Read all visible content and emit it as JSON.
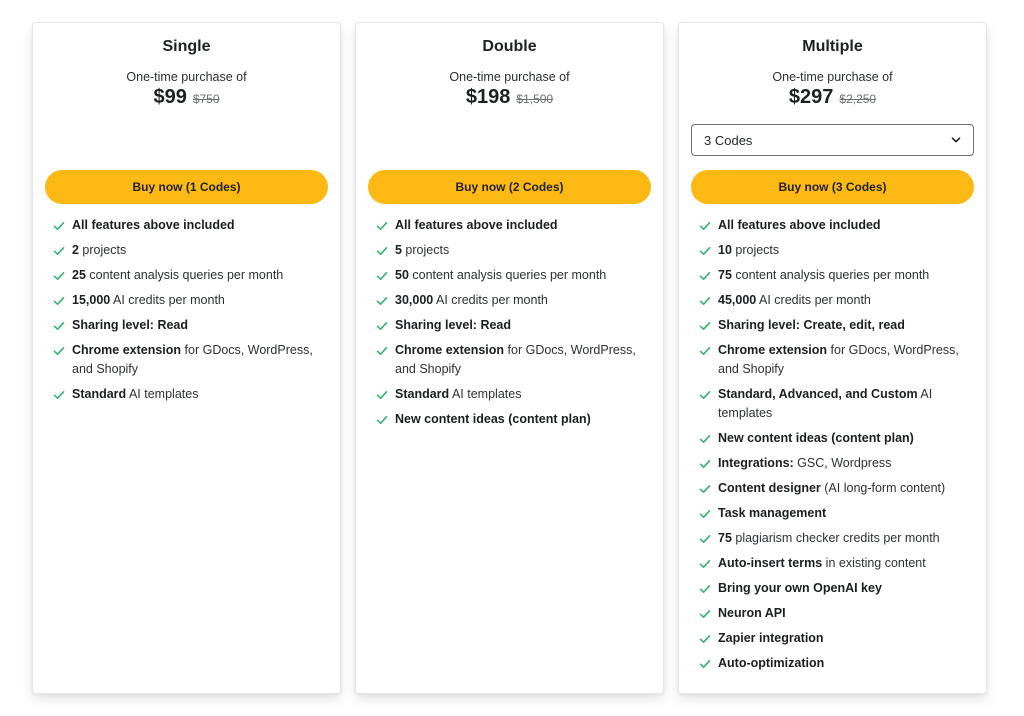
{
  "colors": {
    "accent": "#fdb913",
    "check": "#34b36b"
  },
  "plans": [
    {
      "name": "Single",
      "subtitle": "One-time purchase of",
      "price": "$99",
      "old_price": "$750",
      "button_label": "Buy now (1 Codes)",
      "features": [
        {
          "bold": "All features above included",
          "rest": ""
        },
        {
          "bold": "2",
          "rest": " projects"
        },
        {
          "bold": "25",
          "rest": " content analysis queries per month"
        },
        {
          "bold": "15,000",
          "rest": " AI credits per month"
        },
        {
          "bold": "Sharing level: Read",
          "rest": ""
        },
        {
          "bold": "Chrome extension",
          "rest": " for GDocs, WordPress, and Shopify"
        },
        {
          "bold": "Standard",
          "rest": " AI templates"
        }
      ]
    },
    {
      "name": "Double",
      "subtitle": "One-time purchase of",
      "price": "$198",
      "old_price": "$1,500",
      "button_label": "Buy now (2 Codes)",
      "features": [
        {
          "bold": "All features above included",
          "rest": ""
        },
        {
          "bold": "5",
          "rest": " projects"
        },
        {
          "bold": "50",
          "rest": " content analysis queries per month"
        },
        {
          "bold": "30,000",
          "rest": " AI credits per month"
        },
        {
          "bold": "Sharing level: Read",
          "rest": ""
        },
        {
          "bold": "Chrome extension",
          "rest": " for GDocs, WordPress, and Shopify"
        },
        {
          "bold": "Standard",
          "rest": " AI templates"
        },
        {
          "bold": "New content ideas (content plan)",
          "rest": ""
        }
      ]
    },
    {
      "name": "Multiple",
      "subtitle": "One-time purchase of",
      "price": "$297",
      "old_price": "$2,250",
      "select_value": "3 Codes",
      "button_label": "Buy now (3 Codes)",
      "features": [
        {
          "bold": "All features above included",
          "rest": ""
        },
        {
          "bold": "10",
          "rest": " projects"
        },
        {
          "bold": "75",
          "rest": " content analysis queries per month"
        },
        {
          "bold": "45,000",
          "rest": " AI credits per month"
        },
        {
          "bold": "Sharing level: Create, edit, read",
          "rest": ""
        },
        {
          "bold": "Chrome extension",
          "rest": " for GDocs, WordPress, and Shopify"
        },
        {
          "bold": "Standard, Advanced, and Custom",
          "rest": " AI templates"
        },
        {
          "bold": "New content ideas (content plan)",
          "rest": ""
        },
        {
          "bold": "Integrations:",
          "rest": " GSC, Wordpress"
        },
        {
          "bold": "Content designer",
          "rest": " (AI long-form content)"
        },
        {
          "bold": "Task management",
          "rest": ""
        },
        {
          "bold": "75",
          "rest": " plagiarism checker credits per month"
        },
        {
          "bold": "Auto-insert terms",
          "rest": " in existing content"
        },
        {
          "bold": "Bring your own OpenAI key",
          "rest": ""
        },
        {
          "bold": "Neuron API",
          "rest": ""
        },
        {
          "bold": "Zapier integration",
          "rest": ""
        },
        {
          "bold": "Auto-optimization",
          "rest": ""
        }
      ]
    }
  ]
}
